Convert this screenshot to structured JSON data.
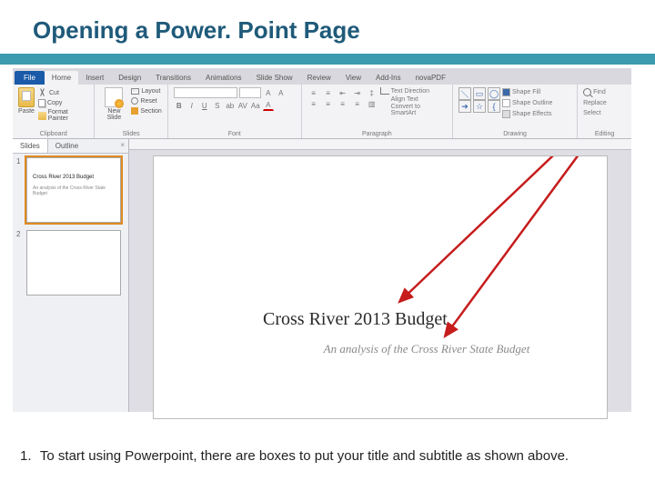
{
  "slide": {
    "title": "Opening a Power. Point Page"
  },
  "ribbon": {
    "file": "File",
    "tabs": [
      "Home",
      "Insert",
      "Design",
      "Transitions",
      "Animations",
      "Slide Show",
      "Review",
      "View",
      "Add-Ins",
      "novaPDF"
    ],
    "clipboard": {
      "paste": "Paste",
      "cut": "Cut",
      "copy": "Copy",
      "format_painter": "Format Painter",
      "label": "Clipboard"
    },
    "slides": {
      "new_slide": "New Slide",
      "layout": "Layout",
      "reset": "Reset",
      "section": "Section",
      "label": "Slides"
    },
    "font": {
      "label": "Font"
    },
    "paragraph": {
      "text_direction": "Text Direction",
      "align_text": "Align Text",
      "smartart": "Convert to SmartArt",
      "label": "Paragraph"
    },
    "drawing": {
      "shape_fill": "Shape Fill",
      "shape_outline": "Shape Outline",
      "shape_effects": "Shape Effects",
      "label": "Drawing"
    },
    "editing": {
      "find": "Find",
      "replace": "Replace",
      "select": "Select",
      "label": "Editing"
    }
  },
  "pane": {
    "slides_tab": "Slides",
    "outline_tab": "Outline",
    "close": "×",
    "thumbs": [
      {
        "num": "1",
        "title": "Cross River 2013 Budget",
        "subtitle": "An analysis of the Cross River State Budget",
        "selected": true
      },
      {
        "num": "2",
        "title": "",
        "subtitle": "",
        "selected": false
      }
    ]
  },
  "canvas": {
    "title_text": "Cross River 2013 Budget",
    "subtitle_text": "An analysis of the Cross River State Budget"
  },
  "instruction": {
    "num": "1.",
    "text": "To start using Powerpoint, there are boxes to put your title and subtitle as shown above."
  }
}
